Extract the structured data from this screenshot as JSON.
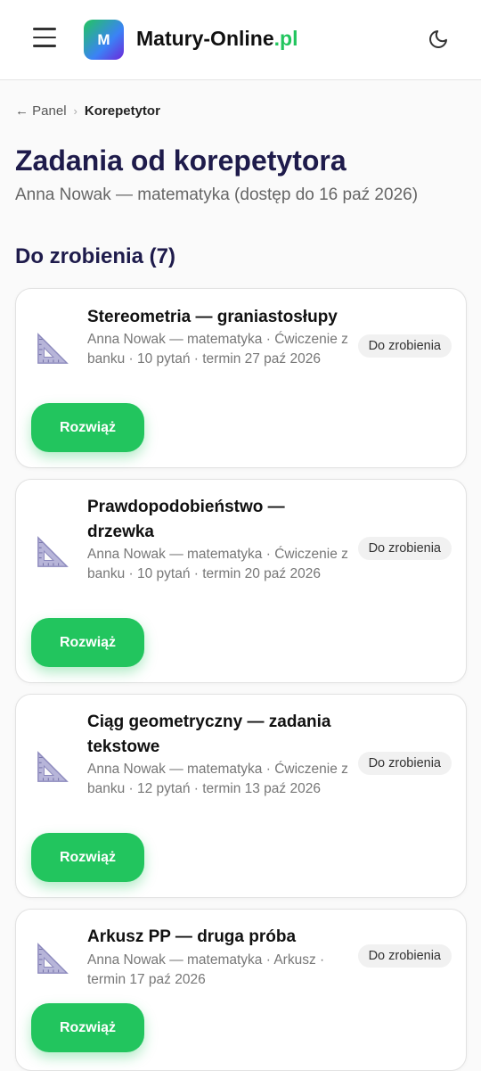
{
  "header": {
    "logo_letter": "M",
    "brand_main": "Matury-Online",
    "brand_tld": ".pl"
  },
  "breadcrumb": {
    "back": "← Panel",
    "separator": "›",
    "current": "Korepetytor"
  },
  "page": {
    "title": "Zadania od korepetytora",
    "subtitle": "Anna Nowak — matematyka (dostęp do 16 paź 2026)",
    "section_title": "Do zrobienia (7)"
  },
  "cards": [
    {
      "title": "Stereometria — graniastosłupy",
      "meta": "Anna Nowak — matematyka · Ćwiczenie z banku · 10 pytań · termin 27 paź 2026",
      "badge": "Do zrobienia",
      "action": "Rozwiąż"
    },
    {
      "title": "Prawdopodobieństwo — drzewka",
      "meta": "Anna Nowak — matematyka · Ćwiczenie z banku · 10 pytań · termin 20 paź 2026",
      "badge": "Do zrobienia",
      "action": "Rozwiąż"
    },
    {
      "title": "Ciąg geometryczny — zadania tekstowe",
      "meta": "Anna Nowak — matematyka · Ćwiczenie z banku · 12 pytań · termin 13 paź 2026",
      "badge": "Do zrobienia",
      "action": "Rozwiąż"
    },
    {
      "title": "Arkusz PP — druga próba",
      "meta": "Anna Nowak — matematyka · Arkusz · termin 17 paź 2026",
      "badge": "Do zrobienia",
      "action": "Rozwiąż"
    }
  ],
  "icons": {
    "menu": "hamburger-icon",
    "theme": "moon-icon",
    "assignment": "set-square-icon"
  },
  "colors": {
    "accent": "#22c55e",
    "heading": "#1e1b4b"
  }
}
